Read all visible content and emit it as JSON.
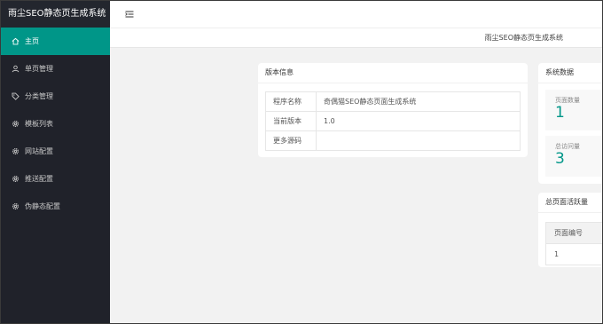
{
  "app": {
    "title": "雨尘SEO静态页生成系统"
  },
  "sidebar": {
    "items": [
      {
        "label": "主页",
        "icon": "home-icon"
      },
      {
        "label": "单页管理",
        "icon": "user-icon"
      },
      {
        "label": "分类管理",
        "icon": "tag-icon"
      },
      {
        "label": "模板列表",
        "icon": "gear-icon"
      },
      {
        "label": "网站配置",
        "icon": "gear-icon"
      },
      {
        "label": "推送配置",
        "icon": "gear-icon"
      },
      {
        "label": "伪静态配置",
        "icon": "gear-icon"
      }
    ],
    "active_index": 0
  },
  "tabbar": {
    "current_tab": "雨尘SEO静态页生成系统"
  },
  "version_card": {
    "title": "版本信息",
    "rows": [
      {
        "key": "程序名称",
        "value": "奇偶猫SEO静态页面生成系统"
      },
      {
        "key": "当前版本",
        "value": "1.0"
      },
      {
        "key": "更多源码",
        "value": ""
      }
    ]
  },
  "stats_card": {
    "title": "系统数据",
    "items": [
      {
        "label": "页面数量",
        "value": "1"
      },
      {
        "label": "总访问量",
        "value": "3"
      }
    ]
  },
  "activity_card": {
    "title": "总页面活跃量",
    "header": "页面编号",
    "rows": [
      "1"
    ]
  },
  "colors": {
    "accent": "#009688",
    "sidebar_bg": "#20222a"
  }
}
